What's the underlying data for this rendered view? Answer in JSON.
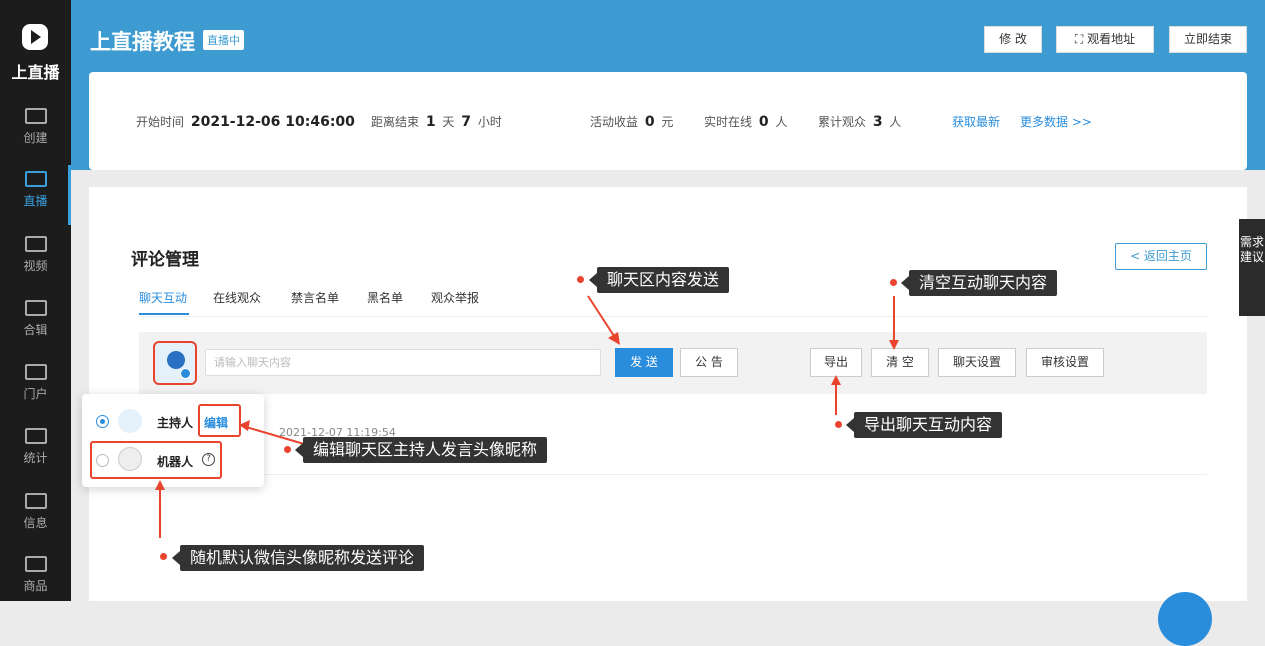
{
  "app": {
    "logo_text": "上直播"
  },
  "sidebar": {
    "items": [
      {
        "label": "创建",
        "icon": "plus-square-icon"
      },
      {
        "label": "直播",
        "icon": "live-screen-icon"
      },
      {
        "label": "视频",
        "icon": "video-icon"
      },
      {
        "label": "合辑",
        "icon": "wallet-icon"
      },
      {
        "label": "门户",
        "icon": "portal-icon"
      },
      {
        "label": "统计",
        "icon": "chart-icon"
      },
      {
        "label": "信息",
        "icon": "message-icon"
      },
      {
        "label": "商品",
        "icon": "shopping-bag-icon"
      }
    ]
  },
  "header": {
    "title": "上直播教程",
    "badge": "直播中",
    "edit_label": "修 改",
    "watch_label": "观看地址",
    "end_label": "立即结束"
  },
  "stats": {
    "start_label": "开始时间",
    "start_value": "2021-12-06 10:46:00",
    "remain_label": "距离结束",
    "remain_days": "1",
    "days_unit": "天",
    "remain_hours": "7",
    "hours_unit": "小时",
    "revenue_label": "活动收益",
    "revenue_value": "0",
    "revenue_unit": "元",
    "online_label": "实时在线",
    "online_value": "0",
    "online_unit": "人",
    "total_label": "累计观众",
    "total_value": "3",
    "total_unit": "人",
    "refresh_link": "获取最新",
    "more_link": "更多数据 >>"
  },
  "comments": {
    "title": "评论管理",
    "back_label": "< 返回主页",
    "tabs": [
      "聊天互动",
      "在线观众",
      "禁言名单",
      "黑名单",
      "观众举报"
    ],
    "input_placeholder": "请输入聊天内容",
    "send_label": "发 送",
    "notice_label": "公 告",
    "export_label": "导出",
    "clear_label": "清 空",
    "chat_settings_label": "聊天设置",
    "review_settings_label": "审核设置",
    "message_time": "2021-12-07 11:19:54"
  },
  "identity_popup": {
    "host_label": "主持人",
    "edit_label": "编辑",
    "robot_label": "机器人",
    "help": "?"
  },
  "annotations": {
    "send": "聊天区内容发送",
    "clear": "清空互动聊天内容",
    "export": "导出聊天互动内容",
    "edit": "编辑聊天区主持人发言头像昵称",
    "robot": "随机默认微信头像昵称发送评论"
  },
  "floating": {
    "demand": "需求建议"
  },
  "colors": {
    "accent": "#3d9bd1",
    "link": "#2a8ddc",
    "annotation_red": "#e8442e"
  }
}
